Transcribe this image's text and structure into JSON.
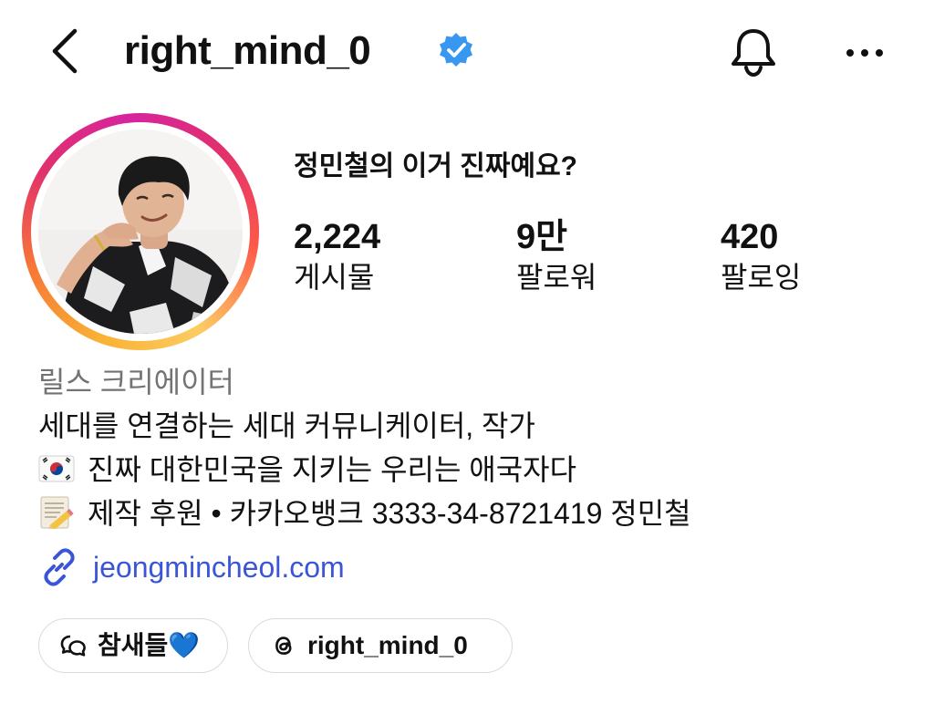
{
  "header": {
    "username": "right_mind_0",
    "back_icon": "chevron-left-icon",
    "verified_icon": "verified-badge-icon",
    "bell_icon": "bell-icon",
    "more_icon": "more-horizontal-icon"
  },
  "profile": {
    "display_name": "정민철의 이거 진짜예요?",
    "stats": {
      "posts": {
        "count": "2,224",
        "label": "게시물"
      },
      "followers": {
        "count": "9만",
        "label": "팔로워"
      },
      "following": {
        "count": "420",
        "label": "팔로잉"
      }
    }
  },
  "bio": {
    "category": "릴스 크리에이터",
    "line1": "세대를 연결하는 세대 커뮤니케이터, 작가",
    "line2": "진짜 대한민국을 지키는 우리는 애국자다",
    "line3": "제작 후원 • 카카오뱅크 3333-34-8721419 정민철",
    "link": "jeongmincheol.com",
    "icons": {
      "line2": "korea-flag-icon",
      "line3": "memo-icon",
      "link": "link-icon"
    }
  },
  "pills": {
    "broadcast": "참새들💙",
    "threads": "right_mind_0"
  },
  "colors": {
    "link": "#3b55d9",
    "verified": "#3897f0",
    "category": "#737373",
    "text": "#111111"
  }
}
